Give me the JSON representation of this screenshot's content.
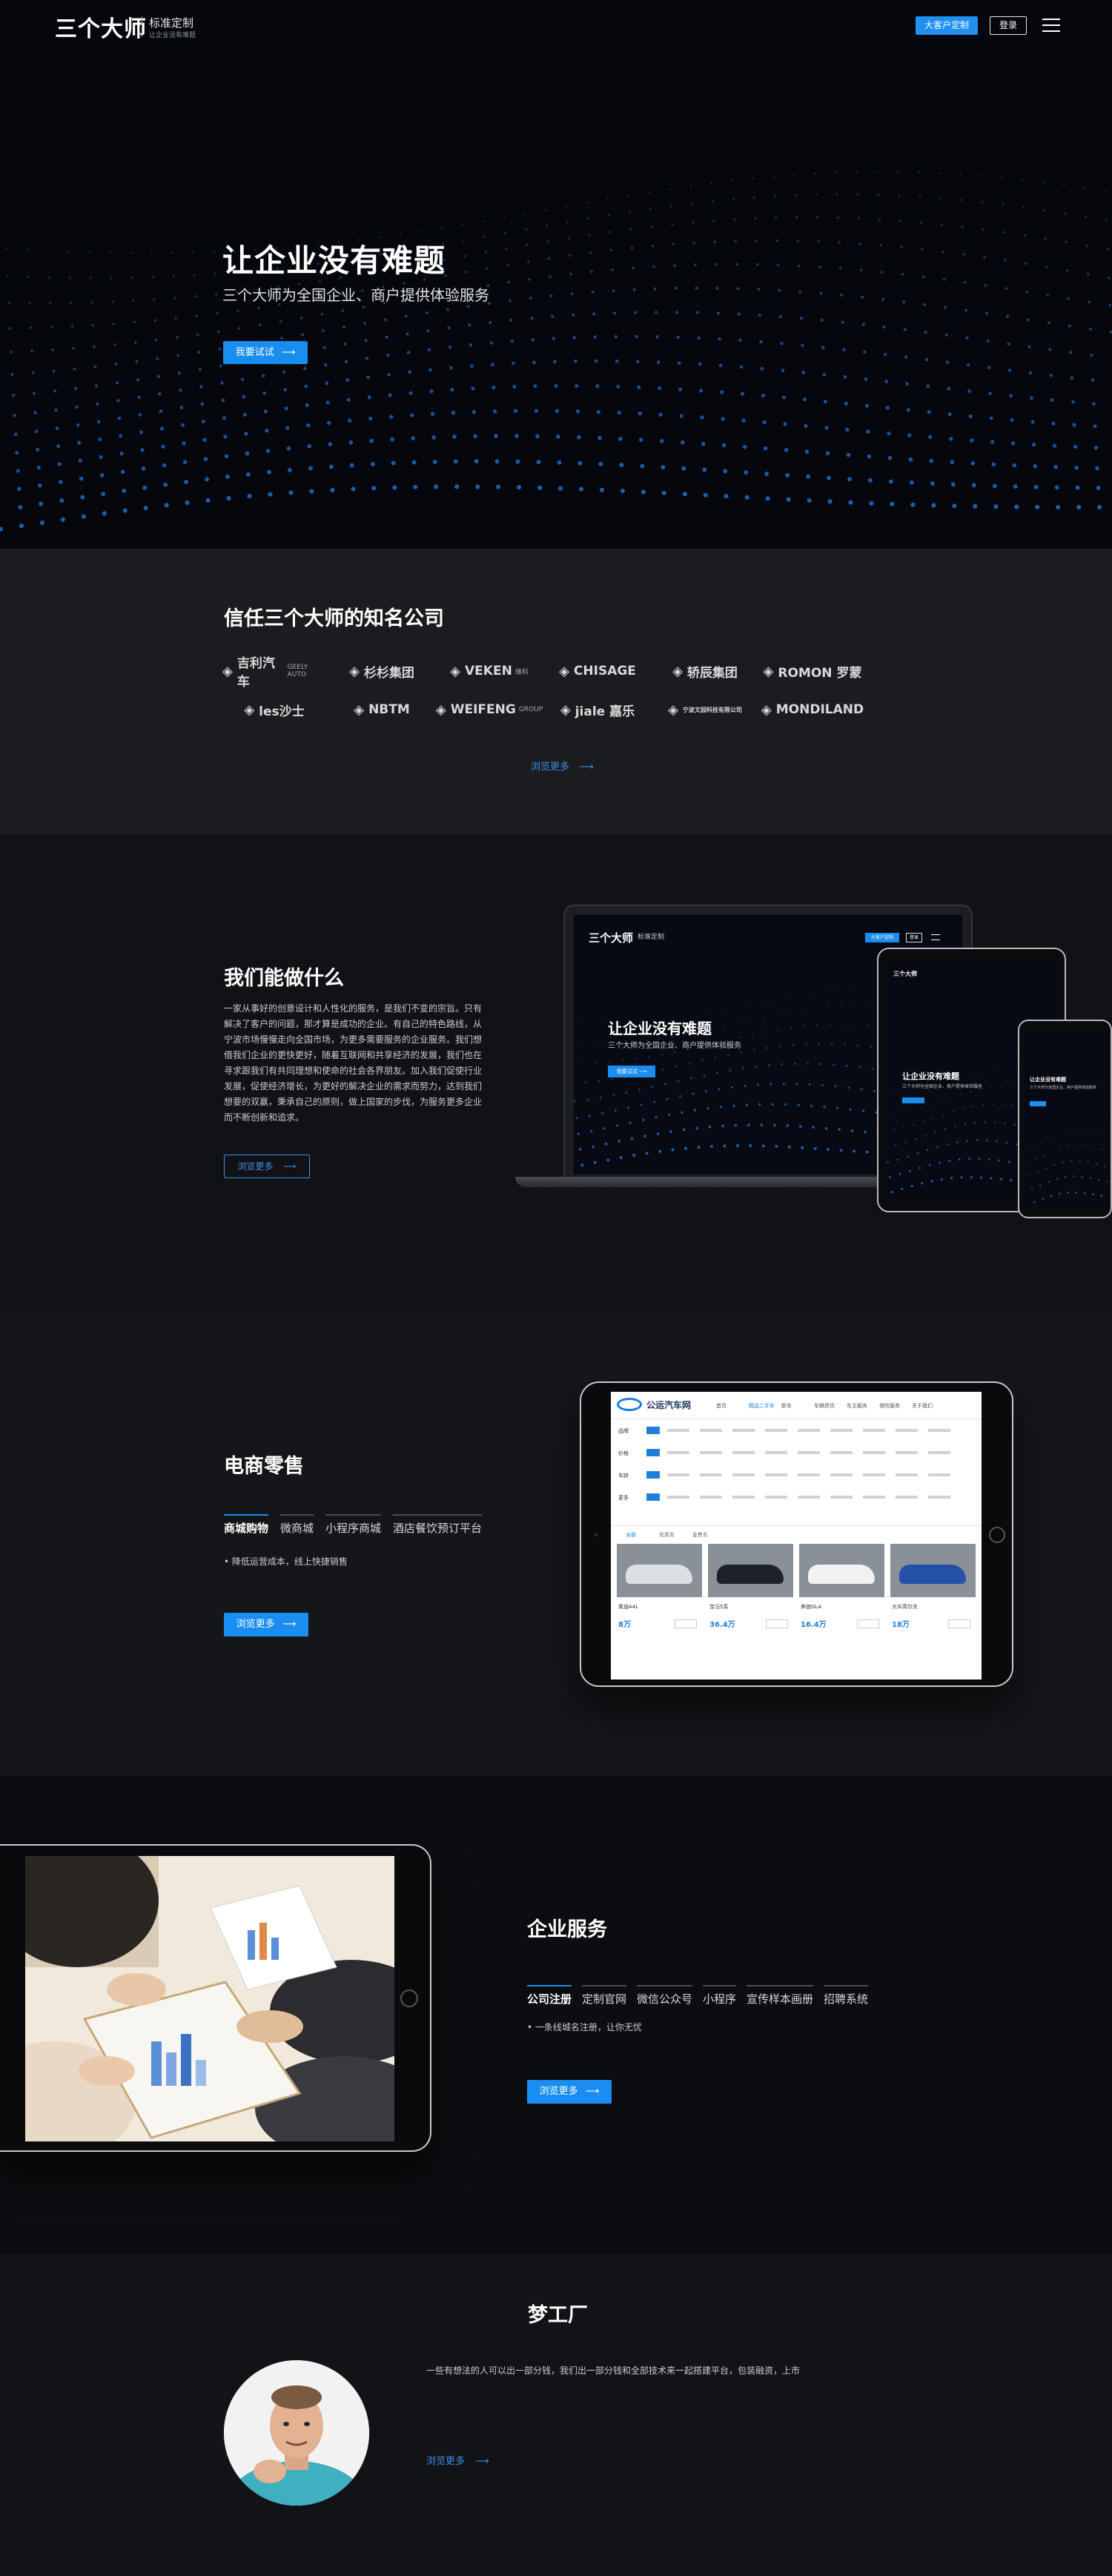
{
  "colors": {
    "accent": "#1a8df0",
    "link": "#3a8ee6",
    "bg": "#0b0d12"
  },
  "header": {
    "logo": "三个大师",
    "logo_sub": "标准定制",
    "logo_tag": "让企业没有难题",
    "custom_button": "大客户定制",
    "login_button": "登录",
    "menu_icon": "hamburger-menu-icon"
  },
  "hero": {
    "title": "让企业没有难题",
    "subtitle": "三个大师为全国企业、商户提供体验服务",
    "cta": "我要试试",
    "arrow": "⟶"
  },
  "trust": {
    "title": "信任三个大师的知名公司",
    "logos": [
      {
        "name": "吉利汽车",
        "en": "GEELY AUTO",
        "icon": "geely-logo-icon"
      },
      {
        "name": "杉杉集团",
        "en": "",
        "icon": "shanshan-logo-icon"
      },
      {
        "name": "VEKEN",
        "en": "维科",
        "icon": "veken-logo-icon"
      },
      {
        "name": "CHISAGE",
        "en": "",
        "icon": "chisage-logo-icon"
      },
      {
        "name": "轿辰集团",
        "en": "",
        "icon": "jiaochen-logo-icon"
      },
      {
        "name": "ROMON 罗蒙",
        "en": "",
        "icon": "romon-logo-icon"
      },
      {
        "name": "les沙士",
        "en": "",
        "icon": "les-logo-icon"
      },
      {
        "name": "NBTM",
        "en": "",
        "icon": "nbtm-logo-icon"
      },
      {
        "name": "WEIFENG",
        "en": "GROUP",
        "icon": "weifeng-logo-icon"
      },
      {
        "name": "jiale 嘉乐",
        "en": "",
        "icon": "jiale-logo-icon"
      },
      {
        "name": "宁波文园科技有限公司",
        "en": "",
        "icon": "company-logo-icon"
      },
      {
        "name": "MONDILAND",
        "en": "",
        "icon": "mondiland-logo-icon"
      }
    ],
    "more": "浏览更多",
    "arrow": "⟶"
  },
  "what": {
    "title": "我们能做什么",
    "paragraph": "一家从事好的创意设计和人性化的服务，是我们不变的宗旨。只有解决了客户的问题，那才算是成功的企业。有自己的特色路线，从宁波市场慢慢走向全国市场，为更多需要服务的企业服务。我们想借我们企业的更快更好，随着互联网和共享经济的发展，我们也在寻求跟我们有共同理想和使命的社会各界朋友。加入我们促使行业发展，促使经济增长，为更好的解决企业的需求而努力，达到我们想要的双赢，秉承自己的原则，做上国家的步伐，为服务更多企业而不断创新和追求。",
    "more": "浏览更多",
    "arrow": "⟶",
    "mock": {
      "logo": "三个大师",
      "logo_sub": "标准定制",
      "custom_button": "大客户定制",
      "login_button": "登录",
      "title": "让企业没有难题",
      "subtitle": "三个大师为全国企业、商户提供体验服务",
      "cta": "我要试试"
    }
  },
  "ecom": {
    "title": "电商零售",
    "tabs": [
      "商城购物",
      "微商城",
      "小程序商城",
      "酒店餐饮预订平台"
    ],
    "bullet": "降低运营成本，线上快捷销售",
    "more": "浏览更多",
    "arrow": "⟶",
    "mock": {
      "site_name": "公运汽车网",
      "nav": [
        "首页",
        "精品二手车",
        "新车",
        "车辆资讯",
        "车主服务",
        "保险服务",
        "关于我们"
      ],
      "filter_labels": [
        "品牌",
        "价格",
        "车龄",
        "更多"
      ],
      "tabs": [
        "全部",
        "优质车",
        "急售车"
      ],
      "cars": [
        {
          "name": "奥迪A4L",
          "price": "8万"
        },
        {
          "name": "宝马5系",
          "price": "36.4万"
        },
        {
          "name": "奔驰GLA",
          "price": "16.4万"
        },
        {
          "name": "大众高尔夫",
          "price": "18万"
        }
      ]
    }
  },
  "ent": {
    "title": "企业服务",
    "tabs": [
      "公司注册",
      "定制官网",
      "微信公众号",
      "小程序",
      "宣传样本画册",
      "招聘系统"
    ],
    "bullet": "一条线城名注册，让你无忧",
    "more": "浏览更多",
    "arrow": "⟶"
  },
  "dream": {
    "title": "梦工厂",
    "text": "一些有想法的人可以出一部分钱，我们出一部分钱和全部技术来一起搭建平台，包装融资，上市",
    "more": "浏览更多",
    "arrow": "⟶"
  }
}
